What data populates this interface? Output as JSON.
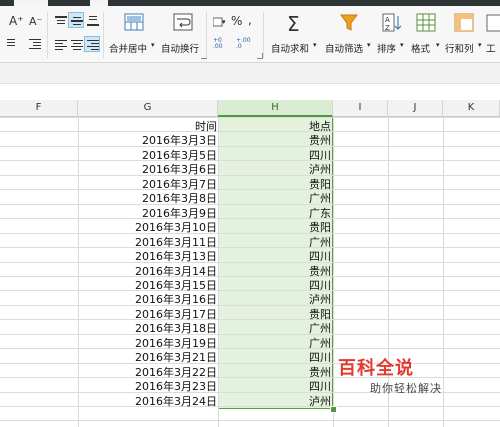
{
  "ribbon": {
    "font_increase": "A⁺",
    "font_decrease": "A⁻",
    "merge_center_label": "合并居中",
    "wrap_text_label": "自动换行",
    "percent_symbol": "%",
    "thousands_symbol": ",",
    "dec_increase": "+0 .00",
    "dec_decrease": "+.00 .0",
    "autosum_symbol": "Σ",
    "autosum_label": "自动求和",
    "autofilter_label": "自动筛选",
    "sort_label": "排序",
    "format_label": "格式",
    "rows_cols_label": "行和列",
    "worksheet_label": "工"
  },
  "columns": [
    "F",
    "G",
    "H",
    "I",
    "J",
    "K"
  ],
  "selected_column": "H",
  "table": {
    "header_g": "时间",
    "header_h": "地点",
    "rows": [
      {
        "date": "2016年3月3日",
        "place": "贵州"
      },
      {
        "date": "2016年3月5日",
        "place": "四川"
      },
      {
        "date": "2016年3月6日",
        "place": "泸州"
      },
      {
        "date": "2016年3月7日",
        "place": "贵阳"
      },
      {
        "date": "2016年3月8日",
        "place": "广州"
      },
      {
        "date": "2016年3月9日",
        "place": "广东"
      },
      {
        "date": "2016年3月10日",
        "place": "贵阳"
      },
      {
        "date": "2016年3月11日",
        "place": "广州"
      },
      {
        "date": "2016年3月13日",
        "place": "四川"
      },
      {
        "date": "2016年3月14日",
        "place": "贵州"
      },
      {
        "date": "2016年3月15日",
        "place": "四川"
      },
      {
        "date": "2016年3月16日",
        "place": "泸州"
      },
      {
        "date": "2016年3月17日",
        "place": "贵阳"
      },
      {
        "date": "2016年3月18日",
        "place": "广州"
      },
      {
        "date": "2016年3月19日",
        "place": "广州"
      },
      {
        "date": "2016年3月21日",
        "place": "四川"
      },
      {
        "date": "2016年3月22日",
        "place": "贵州"
      },
      {
        "date": "2016年3月23日",
        "place": "四川"
      },
      {
        "date": "2016年3月24日",
        "place": "泸州"
      }
    ]
  },
  "watermark": {
    "logo_text": "百科全说",
    "sub_text": "助你轻松解决"
  },
  "colors": {
    "selection": "#e4f1dc",
    "selection_border": "#5a9e47",
    "filter_icon": "#f0a020",
    "logo_red": "#e23b2e"
  }
}
